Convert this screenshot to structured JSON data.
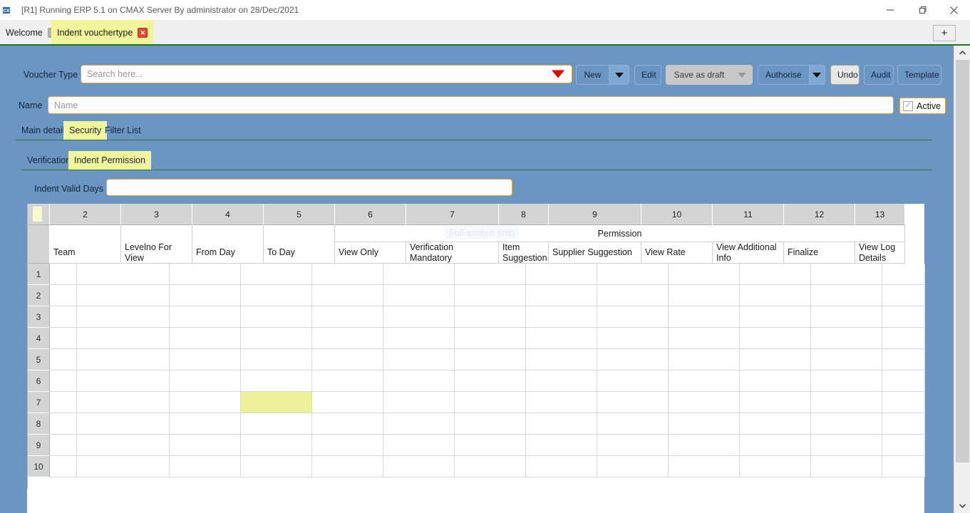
{
  "window": {
    "title": "[R1] Running ERP 5.1 on CMAX Server By administrator on 28/Dec/2021",
    "icon": "app-icon",
    "minimize": "minimize-icon",
    "maximize": "restore-icon",
    "close": "close-icon"
  },
  "tabbar": {
    "tabs": [
      {
        "label": "Welcome",
        "active": false,
        "close": "✕"
      },
      {
        "label": "Indent vouchertype",
        "active": true,
        "close": "✕"
      }
    ],
    "new_tab_label": "+"
  },
  "toolbar": {
    "voucher_type_label": "Voucher Type",
    "search_placeholder": "Search here...",
    "search_value": "",
    "buttons": [
      {
        "label": "New",
        "split": true,
        "state": "normal"
      },
      {
        "label": "Edit",
        "split": false,
        "state": "normal"
      },
      {
        "label": "Save as draft",
        "split": true,
        "state": "disabled"
      },
      {
        "label": "Authorise",
        "split": true,
        "state": "normal"
      },
      {
        "label": "Undo",
        "split": false,
        "state": "hover"
      },
      {
        "label": "Audit",
        "split": false,
        "state": "normal"
      },
      {
        "label": "Template",
        "split": false,
        "state": "normal"
      }
    ],
    "name_label": "Name",
    "name_placeholder": "Name",
    "name_value": "",
    "active_label": "Active",
    "active_checked": true,
    "active_check_glyph": "✓"
  },
  "tabs_primary": {
    "items": [
      {
        "label": "Main details",
        "selected": false
      },
      {
        "label": "Security",
        "selected": true
      },
      {
        "label": "Filter List",
        "selected": false
      }
    ]
  },
  "tabs_secondary": {
    "items": [
      {
        "label": "Verification",
        "selected": false
      },
      {
        "label": "Indent Permission",
        "selected": true
      }
    ]
  },
  "form": {
    "indent_valid_days_label": "Indent Valid Days",
    "indent_valid_days_value": ""
  },
  "watermark": {
    "text": "Full-screen snip"
  },
  "grid": {
    "column_numbers": [
      "2",
      "3",
      "4",
      "5",
      "6",
      "7",
      "8",
      "9",
      "10",
      "11",
      "12",
      "13"
    ],
    "group_header": "Permission",
    "headers": [
      "Team",
      "Levelno For View",
      "From Day",
      "To Day",
      "View Only",
      "Verification Mandatory",
      "Item Suggestion",
      "Supplier Suggestion",
      "View Rate",
      "View Additional Info",
      "Finalize",
      "View Log Details"
    ],
    "row_numbers": [
      "1",
      "2",
      "3",
      "4",
      "5",
      "6",
      "7",
      "8",
      "9",
      "10"
    ],
    "selected_cell": {
      "row": 7,
      "column": 3
    },
    "cell_values": [
      [
        "",
        "",
        "",
        "",
        "",
        "",
        "",
        "",
        "",
        "",
        "",
        ""
      ],
      [
        "",
        "",
        "",
        "",
        "",
        "",
        "",
        "",
        "",
        "",
        "",
        ""
      ],
      [
        "",
        "",
        "",
        "",
        "",
        "",
        "",
        "",
        "",
        "",
        "",
        ""
      ],
      [
        "",
        "",
        "",
        "",
        "",
        "",
        "",
        "",
        "",
        "",
        "",
        ""
      ],
      [
        "",
        "",
        "",
        "",
        "",
        "",
        "",
        "",
        "",
        "",
        "",
        ""
      ],
      [
        "",
        "",
        "",
        "",
        "",
        "",
        "",
        "",
        "",
        "",
        "",
        ""
      ],
      [
        "",
        "",
        "",
        "",
        "",
        "",
        "",
        "",
        "",
        "",
        "",
        ""
      ],
      [
        "",
        "",
        "",
        "",
        "",
        "",
        "",
        "",
        "",
        "",
        "",
        ""
      ],
      [
        "",
        "",
        "",
        "",
        "",
        "",
        "",
        "",
        "",
        "",
        "",
        ""
      ],
      [
        "",
        "",
        "",
        "",
        "",
        "",
        "",
        "",
        "",
        "",
        "",
        ""
      ]
    ]
  },
  "colors": {
    "panel_blue": "#6b96c4",
    "tab_highlight": "#f2f59a",
    "field_border": "#e8a33d",
    "green_rule": "#207520",
    "cell_highlight": "#eef09a",
    "close_red": "#e8462f"
  }
}
